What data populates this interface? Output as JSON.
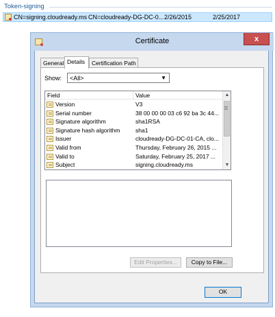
{
  "background": {
    "section_title": "Token-signing",
    "token_row": {
      "subject": "CN=signing.cloudready.ms",
      "issuer": "CN=cloudready-DG-DC-0...",
      "valid_from": "2/26/2015",
      "valid_to": "2/25/2017"
    }
  },
  "dialog": {
    "title": "Certificate",
    "close_label": "x",
    "tabs": [
      {
        "label": "General",
        "active": false
      },
      {
        "label": "Details",
        "active": true
      },
      {
        "label": "Certification Path",
        "active": false
      }
    ],
    "show_label": "Show:",
    "show_value": "<All>",
    "columns": {
      "field": "Field",
      "value": "Value"
    },
    "rows": [
      {
        "field": "Version",
        "value": "V3"
      },
      {
        "field": "Serial number",
        "value": "38 00 00 00 03 c6 92 ba 3c 44..."
      },
      {
        "field": "Signature algorithm",
        "value": "sha1RSA"
      },
      {
        "field": "Signature hash algorithm",
        "value": "sha1"
      },
      {
        "field": "Issuer",
        "value": "cloudready-DG-DC-01-CA, clo..."
      },
      {
        "field": "Valid from",
        "value": "Thursday, February 26, 2015 ..."
      },
      {
        "field": "Valid to",
        "value": "Saturday, February 25, 2017 ..."
      },
      {
        "field": "Subject",
        "value": "signing.cloudready.ms"
      }
    ],
    "buttons": {
      "edit_properties": "Edit Properties...",
      "copy_to_file": "Copy to File...",
      "ok": "OK"
    }
  }
}
